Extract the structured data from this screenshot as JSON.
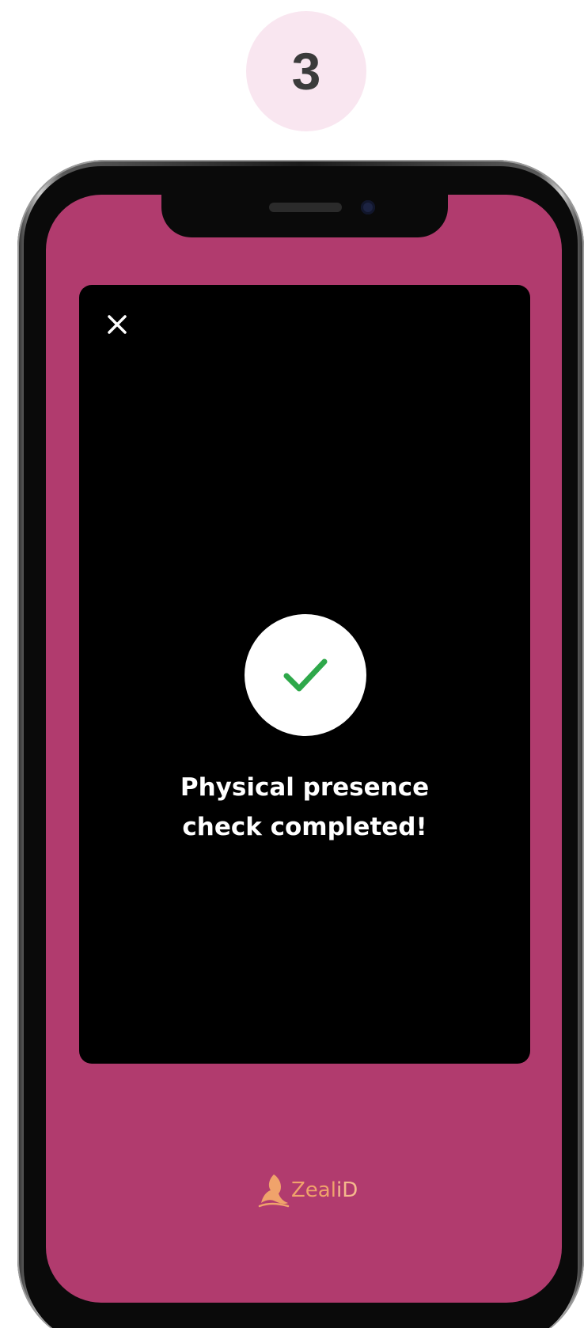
{
  "step": {
    "number": "3"
  },
  "dialog": {
    "close_icon": "close-icon",
    "status_icon": "check-icon",
    "message_line1": "Physical presence",
    "message_line2": "check completed!"
  },
  "brand": {
    "name_main": "Zeal",
    "name_accent": "iD",
    "icon": "zealid-logo"
  },
  "colors": {
    "screen_background": "#b13b6e",
    "dialog_background": "#000000",
    "check_green": "#2ea84a",
    "step_badge_background": "#f9e6f0",
    "brand_color": "#f0a36b"
  }
}
